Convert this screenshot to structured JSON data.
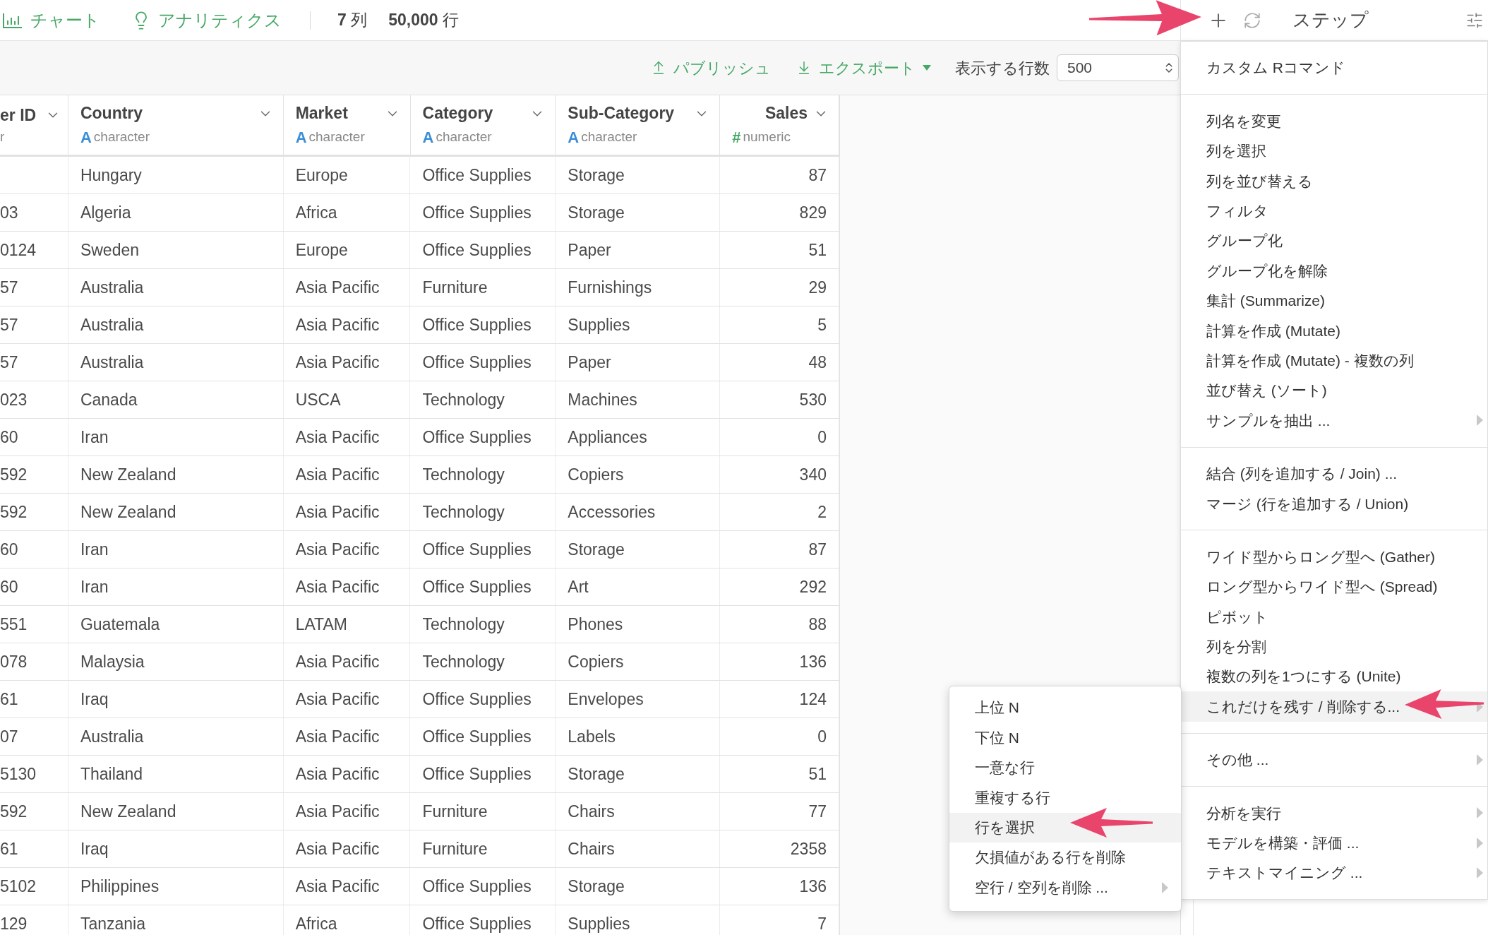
{
  "top_bar": {
    "tabs": [
      {
        "label": "チャート",
        "kind": "chart"
      },
      {
        "label": "アナリティクス",
        "kind": "analytics"
      }
    ],
    "summary": [
      {
        "number": "7",
        "unit": "列"
      },
      {
        "number": "50,000",
        "unit": "行"
      }
    ],
    "step_title": "ステップ"
  },
  "toolbar": {
    "publish": "パブリッシュ",
    "export": "エクスポート",
    "rows_label": "表示する行数",
    "rows_value": "500"
  },
  "table": {
    "columns": [
      {
        "name": "er ID",
        "type": "r"
      },
      {
        "name": "Country",
        "type_icon": "A",
        "type": "character",
        "kind": "character"
      },
      {
        "name": "Market",
        "type_icon": "A",
        "type": "character",
        "kind": "character"
      },
      {
        "name": "Category",
        "type_icon": "A",
        "type": "character",
        "kind": "character"
      },
      {
        "name": "Sub-Category",
        "type_icon": "A",
        "type": "character",
        "kind": "character"
      },
      {
        "name": "Sales",
        "type_icon": "#",
        "type": "numeric",
        "kind": "numeric"
      }
    ],
    "rows": [
      {
        "country": "Hungary",
        "market": "Europe",
        "category": "Office Supplies",
        "sub_category": "Storage",
        "sales": "87"
      },
      {
        "column_1": "03",
        "country": "Algeria",
        "market": "Africa",
        "category": "Office Supplies",
        "sub_category": "Storage",
        "sales": "829"
      },
      {
        "column_1": "0124",
        "country": "Sweden",
        "market": "Europe",
        "category": "Office Supplies",
        "sub_category": "Paper",
        "sales": "51"
      },
      {
        "column_1": "57",
        "country": "Australia",
        "market": "Asia Pacific",
        "category": "Furniture",
        "sub_category": "Furnishings",
        "sales": "29"
      },
      {
        "column_1": "57",
        "country": "Australia",
        "market": "Asia Pacific",
        "category": "Office Supplies",
        "sub_category": "Supplies",
        "sales": "5"
      },
      {
        "column_1": "57",
        "country": "Australia",
        "market": "Asia Pacific",
        "category": "Office Supplies",
        "sub_category": "Paper",
        "sales": "48"
      },
      {
        "column_1": "023",
        "country": "Canada",
        "market": "USCA",
        "category": "Technology",
        "sub_category": "Machines",
        "sales": "530"
      },
      {
        "column_1": "60",
        "country": "Iran",
        "market": "Asia Pacific",
        "category": "Office Supplies",
        "sub_category": "Appliances",
        "sales": "0"
      },
      {
        "column_1": "592",
        "country": "New Zealand",
        "market": "Asia Pacific",
        "category": "Technology",
        "sub_category": "Copiers",
        "sales": "340"
      },
      {
        "column_1": "592",
        "country": "New Zealand",
        "market": "Asia Pacific",
        "category": "Technology",
        "sub_category": "Accessories",
        "sales": "2"
      },
      {
        "column_1": "60",
        "country": "Iran",
        "market": "Asia Pacific",
        "category": "Office Supplies",
        "sub_category": "Storage",
        "sales": "87"
      },
      {
        "column_1": "60",
        "country": "Iran",
        "market": "Asia Pacific",
        "category": "Office Supplies",
        "sub_category": "Art",
        "sales": "292"
      },
      {
        "column_1": "551",
        "country": "Guatemala",
        "market": "LATAM",
        "category": "Technology",
        "sub_category": "Phones",
        "sales": "88"
      },
      {
        "column_1": "078",
        "country": "Malaysia",
        "market": "Asia Pacific",
        "category": "Technology",
        "sub_category": "Copiers",
        "sales": "136"
      },
      {
        "column_1": "61",
        "country": "Iraq",
        "market": "Asia Pacific",
        "category": "Office Supplies",
        "sub_category": "Envelopes",
        "sales": "124"
      },
      {
        "column_1": "07",
        "country": "Australia",
        "market": "Asia Pacific",
        "category": "Office Supplies",
        "sub_category": "Labels",
        "sales": "0"
      },
      {
        "column_1": "5130",
        "country": "Thailand",
        "market": "Asia Pacific",
        "category": "Office Supplies",
        "sub_category": "Storage",
        "sales": "51"
      },
      {
        "column_1": "592",
        "country": "New Zealand",
        "market": "Asia Pacific",
        "category": "Furniture",
        "sub_category": "Chairs",
        "sales": "77"
      },
      {
        "column_1": "61",
        "country": "Iraq",
        "market": "Asia Pacific",
        "category": "Furniture",
        "sub_category": "Chairs",
        "sales": "2358"
      },
      {
        "column_1": "5102",
        "country": "Philippines",
        "market": "Asia Pacific",
        "category": "Office Supplies",
        "sub_category": "Storage",
        "sales": "136"
      },
      {
        "column_1": "129",
        "country": "Tanzania",
        "market": "Africa",
        "category": "Office Supplies",
        "sub_category": "Supplies",
        "sales": "7"
      }
    ]
  },
  "menu": {
    "sections": [
      [
        {
          "label": "カスタム Rコマンド",
          "highlighted": false,
          "submenu": false
        }
      ],
      [
        {
          "label": "列名を変更",
          "highlighted": false,
          "submenu": false
        },
        {
          "label": "列を選択",
          "highlighted": false,
          "submenu": false
        },
        {
          "label": "列を並び替える",
          "highlighted": false,
          "submenu": false
        },
        {
          "label": "フィルタ",
          "highlighted": false,
          "submenu": false
        },
        {
          "label": "グループ化",
          "highlighted": false,
          "submenu": false
        },
        {
          "label": "グループ化を解除",
          "highlighted": false,
          "submenu": false
        },
        {
          "label": "集計 (Summarize)",
          "highlighted": false,
          "submenu": false
        },
        {
          "label": "計算を作成 (Mutate)",
          "highlighted": false,
          "submenu": false
        },
        {
          "label": "計算を作成 (Mutate) - 複数の列",
          "highlighted": false,
          "submenu": false
        },
        {
          "label": "並び替え (ソート)",
          "highlighted": false,
          "submenu": false
        },
        {
          "label": "サンプルを抽出 ...",
          "highlighted": false,
          "submenu": true
        }
      ],
      [
        {
          "label": "結合 (列を追加する / Join) ...",
          "highlighted": false,
          "submenu": false
        },
        {
          "label": "マージ (行を追加する / Union)",
          "highlighted": false,
          "submenu": false
        }
      ],
      [
        {
          "label": "ワイド型からロング型へ (Gather)",
          "highlighted": false,
          "submenu": false
        },
        {
          "label": "ロング型からワイド型へ (Spread)",
          "highlighted": false,
          "submenu": false
        },
        {
          "label": "ピボット",
          "highlighted": false,
          "submenu": false
        },
        {
          "label": "列を分割",
          "highlighted": false,
          "submenu": false
        },
        {
          "label": "複数の列を1つにする (Unite)",
          "highlighted": false,
          "submenu": false
        },
        {
          "label": "これだけを残す / 削除する...",
          "highlighted": true,
          "submenu": true
        }
      ],
      [
        {
          "label": "その他 ...",
          "highlighted": false,
          "submenu": true
        }
      ],
      [
        {
          "label": "分析を実行",
          "highlighted": false,
          "submenu": true
        },
        {
          "label": "モデルを構築・評価 ...",
          "highlighted": false,
          "submenu": true
        },
        {
          "label": "テキストマイニング ...",
          "highlighted": false,
          "submenu": true
        }
      ]
    ]
  },
  "submenu": {
    "items": [
      {
        "label": "上位 N",
        "highlighted": false,
        "submenu": false
      },
      {
        "label": "下位 N",
        "highlighted": false,
        "submenu": false
      },
      {
        "label": "一意な行",
        "highlighted": false,
        "submenu": false
      },
      {
        "label": "重複する行",
        "highlighted": false,
        "submenu": false
      },
      {
        "label": "行を選択",
        "highlighted": true,
        "submenu": false
      },
      {
        "label": "欠損値がある行を削除",
        "highlighted": false,
        "submenu": false
      },
      {
        "label": "空行 / 空列を削除 ...",
        "highlighted": false,
        "submenu": true
      }
    ]
  }
}
